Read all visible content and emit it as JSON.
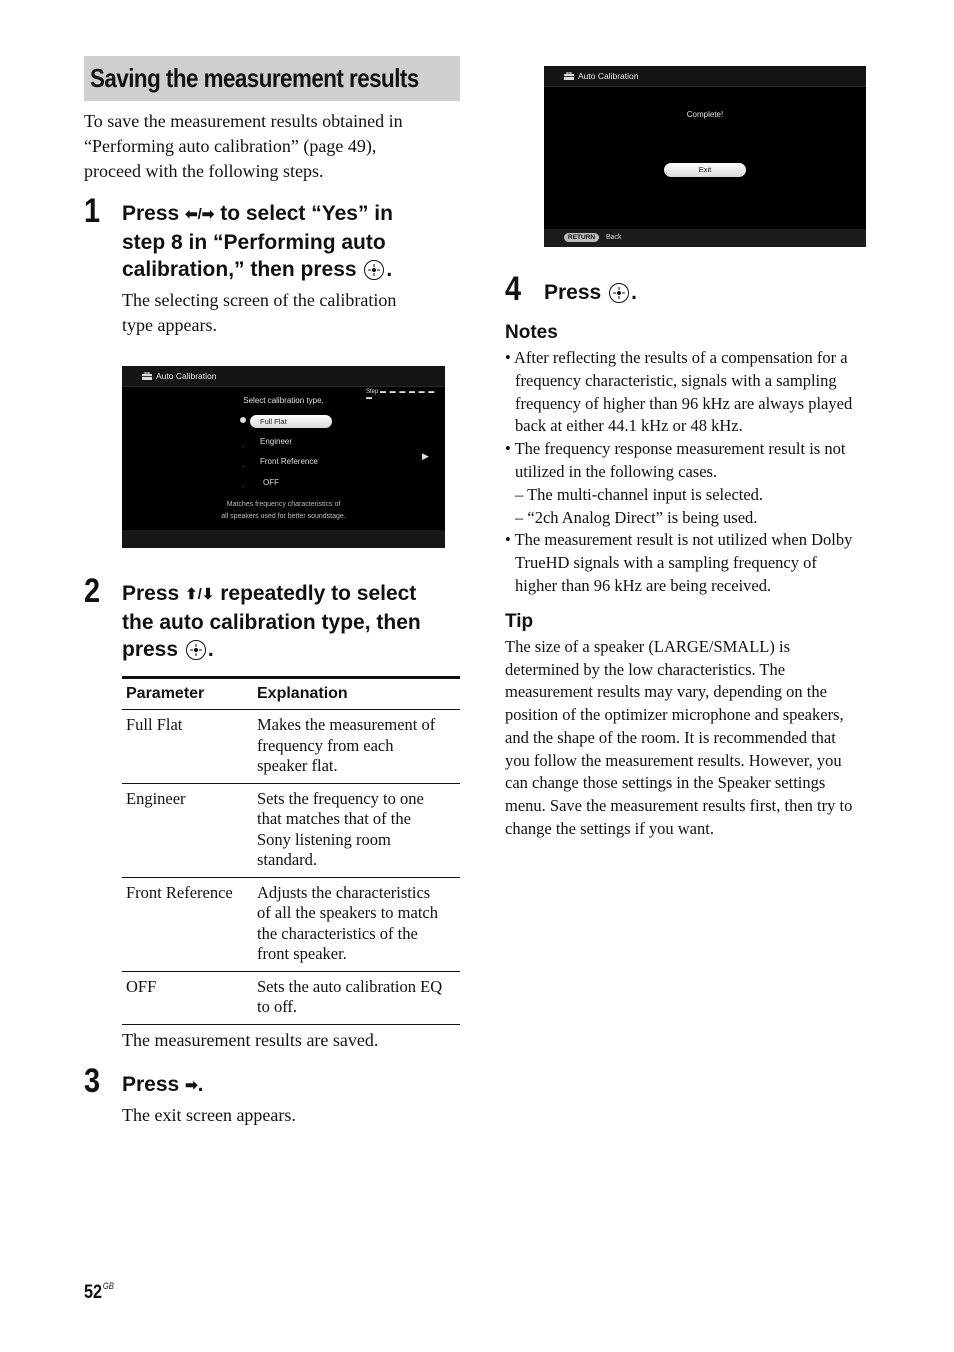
{
  "section": {
    "title": "Saving the measurement results",
    "intro_lines": [
      "To save the measurement results obtained in",
      "“Performing auto calibration” (page 49),",
      "proceed with the following steps."
    ]
  },
  "steps": [
    {
      "number": "1",
      "heading_lines": [
        "Press",
        "to select “Yes” in",
        "step 8 in “Performing auto",
        "calibration,” then press",
        "."
      ],
      "arrow_keys": "◆/◆",
      "description_lines": [
        "The selecting screen of the calibration",
        "type appears."
      ]
    },
    {
      "number": "2",
      "heading_lines": [
        "Press",
        "repeatedly to select",
        "the auto calibration type, then",
        "press",
        "."
      ],
      "arrow_keys": "↑/↓"
    },
    {
      "number": "3",
      "heading": "Press",
      "arrow_key": "→",
      "heading_suffix": ".",
      "description": "The exit screen appears."
    },
    {
      "number": "4",
      "heading": "Press",
      "heading_suffix": "."
    }
  ],
  "screen_select": {
    "title": "Auto Calibration",
    "step_label": "Step",
    "prompt": "Select calibration type.",
    "options": [
      {
        "label": "Full Flat",
        "selected": true
      },
      {
        "label": "Engineer",
        "selected": false
      },
      {
        "label": "Front Reference",
        "selected": false
      },
      {
        "label": "OFF",
        "selected": false
      }
    ],
    "description_lines": [
      "Matches frequency characteristics of",
      "all speakers used for better soundstage."
    ],
    "next_arrow": "▶"
  },
  "screen_complete": {
    "title": "Auto Calibration",
    "message": "Complete!",
    "exit_button": "Exit",
    "footer_key": "RETURN",
    "footer_label": "Back"
  },
  "table": {
    "headers": [
      "Parameter",
      "Explanation"
    ],
    "rows": [
      {
        "parameter": "Full Flat",
        "explanation": [
          "Makes the measurement of",
          "frequency from each",
          "speaker flat."
        ]
      },
      {
        "parameter": "Engineer",
        "explanation": [
          "Sets the frequency to one",
          "that matches that of the",
          "Sony listening room",
          "standard."
        ]
      },
      {
        "parameter": "Front Reference",
        "explanation": [
          "Adjusts the characteristics",
          "of all the speakers to match",
          "the characteristics of the",
          "front speaker."
        ]
      },
      {
        "parameter": "OFF",
        "explanation": [
          "Sets the auto calibration EQ",
          "to off."
        ]
      }
    ]
  },
  "after_table": "The measurement results are saved.",
  "notes": {
    "heading": "Notes",
    "items": [
      {
        "type": "bullet",
        "lines": [
          "• After reflecting the results of a compensation for a",
          "frequency characteristic, signals with a sampling",
          "frequency of higher than 96 kHz are always played",
          "back at either 44.1 kHz or 48 kHz."
        ]
      },
      {
        "type": "bullet",
        "lines": [
          "• The frequency response measurement result is not",
          "utilized in the following cases."
        ]
      },
      {
        "type": "dash",
        "lines": [
          "–  The multi-channel input is selected."
        ]
      },
      {
        "type": "dash",
        "lines": [
          "–  “2ch Analog Direct” is being used."
        ]
      },
      {
        "type": "bullet",
        "lines": [
          "• The measurement result is not utilized when Dolby",
          "TrueHD signals with a sampling frequency of",
          "higher than 96 kHz are being received."
        ]
      }
    ]
  },
  "tip": {
    "heading": "Tip",
    "lines": [
      "The size of a speaker (LARGE/SMALL) is",
      "determined by the low characteristics. The",
      "measurement results may vary, depending on the",
      "position of the optimizer microphone and speakers,",
      "and the shape of the room. It is recommended that",
      "you follow the measurement results. However, you",
      "can change those settings in the Speaker settings",
      "menu. Save the measurement results first, then try to",
      "change the settings if you want."
    ]
  },
  "footer": {
    "page_number": "52",
    "region": "GB"
  }
}
